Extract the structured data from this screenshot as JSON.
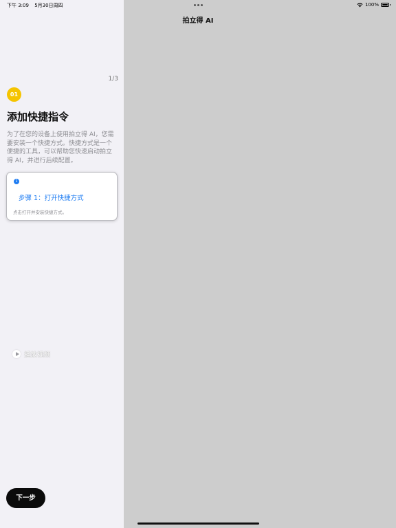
{
  "status_bar": {
    "time": "下午 3:09",
    "date": "5月30日周四",
    "battery": "100%",
    "icons": [
      "wifi-icon",
      "battery-icon"
    ]
  },
  "nav": {
    "title": "拍立得 AI"
  },
  "onboarding": {
    "page_indicator": "1/3",
    "step_badge": "01",
    "title": "添加快捷指令",
    "description": "为了在您的设备上使用拍立得 AI，您需要安装一个快捷方式。快捷方式是一个便捷的工具，可以帮助您快速启动拍立得 AI，并进行后续配置。",
    "card": {
      "number": "1",
      "link_label": "步骤 1：打开快捷方式",
      "hint": "点击打开并安装快捷方式。"
    },
    "play_video_label": "播放视频",
    "next_button_label": "下一步"
  },
  "colors": {
    "accent_yellow": "#f5c400",
    "link_blue": "#1e7cf2",
    "sidebar_bg": "#f2f1f6",
    "detail_bg": "#cdcdcd",
    "button_dark": "#0b0b0b"
  }
}
